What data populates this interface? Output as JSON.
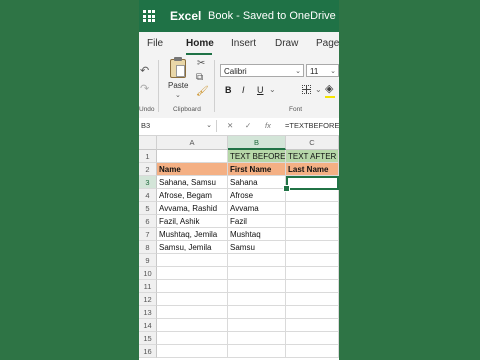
{
  "title_bar": {
    "app_name": "Excel",
    "doc_title": "Book - Saved to OneDrive"
  },
  "ribbon_tabs": [
    {
      "label": "File"
    },
    {
      "label": "Home",
      "active": true
    },
    {
      "label": "Insert"
    },
    {
      "label": "Draw"
    },
    {
      "label": "Page"
    }
  ],
  "ribbon": {
    "undo_label": "Undo",
    "paste_label": "Paste",
    "clipboard_label": "Clipboard",
    "font_name": "Calibri",
    "font_size": "11",
    "font_group_label": "Font",
    "bold": "B",
    "italic": "I",
    "underline": "U"
  },
  "formula_bar": {
    "name_box": "B3",
    "fx": "fx",
    "formula": "=TEXTBEFORE("
  },
  "columns": [
    "A",
    "B",
    "C"
  ],
  "rows": [
    "1",
    "2",
    "3",
    "4",
    "5",
    "6",
    "7",
    "8",
    "9",
    "10",
    "11",
    "12",
    "13",
    "14",
    "15",
    "16"
  ],
  "cells": {
    "b1": "TEXT BEFORE",
    "c1": "TEXT AFTER",
    "a2": "Name",
    "b2": "First Name",
    "c2": "Last Name",
    "data": [
      {
        "a": "Sahana, Samsu",
        "b": "Sahana"
      },
      {
        "a": "Afrose, Begam",
        "b": "Afrose"
      },
      {
        "a": "Avvama, Rashid",
        "b": "Avvama"
      },
      {
        "a": "Fazil, Ashik",
        "b": "Fazil"
      },
      {
        "a": "Mushtaq, Jemila",
        "b": "Mushtaq"
      },
      {
        "a": "Samsu, Jemila",
        "b": "Samsu"
      }
    ]
  },
  "colors": {
    "brand": "#217346",
    "header_green": "#b6d7a8",
    "header_orange": "#f4b084",
    "background": "#2e7445"
  }
}
